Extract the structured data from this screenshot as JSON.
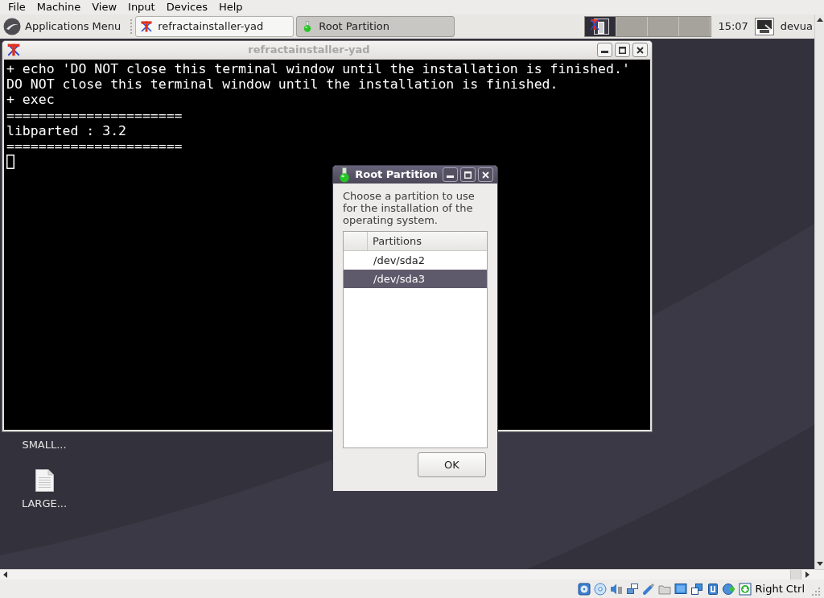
{
  "menu_bar": [
    "File",
    "Machine",
    "View",
    "Input",
    "Devices",
    "Help"
  ],
  "panel": {
    "applications_menu": "Applications Menu",
    "tasks": [
      {
        "label": "refractainstaller-yad",
        "selected": false
      },
      {
        "label": "Root Partition",
        "selected": true
      }
    ],
    "workspaces": [
      {
        "selected": true
      },
      {
        "selected": false
      },
      {
        "selected": false
      },
      {
        "selected": false
      }
    ],
    "clock": "15:07",
    "user": "devua"
  },
  "terminal_window": {
    "title": "refractainstaller-yad",
    "focused": false,
    "lines": [
      "+ echo 'DO NOT close this terminal window until the installation is finished.'",
      "DO NOT close this terminal window until the installation is finished.",
      "+ exec",
      "======================",
      "libparted : 3.2",
      "======================"
    ]
  },
  "desktop_icons": [
    {
      "label": "SMALL..."
    },
    {
      "label": "LARGE..."
    }
  ],
  "dialog": {
    "title": "Root Partition",
    "focused": true,
    "message": "Choose a partition to use for the installation of the operating system.",
    "list": {
      "column": "Partitions",
      "rows": [
        {
          "value": "/dev/sda2",
          "selected": false
        },
        {
          "value": "/dev/sda3",
          "selected": true
        }
      ]
    },
    "button": "OK"
  },
  "status_bar": {
    "host_key": "Right Ctrl"
  }
}
